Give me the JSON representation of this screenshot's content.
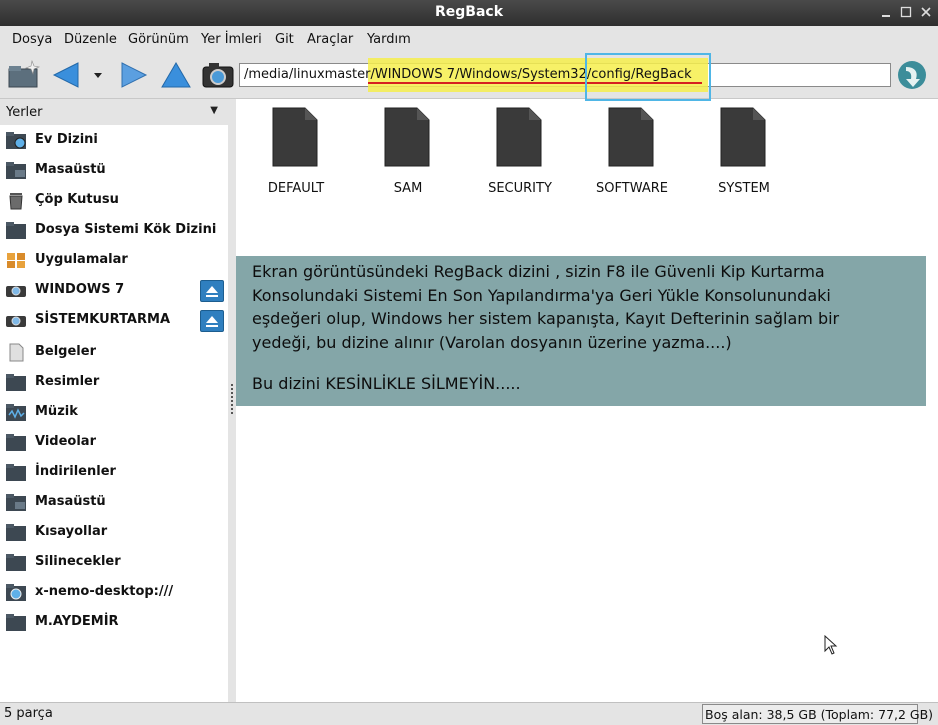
{
  "window": {
    "title": "RegBack"
  },
  "menu": [
    "Dosya",
    "Düzenle",
    "Görünüm",
    "Yer İmleri",
    "Git",
    "Araçlar",
    "Yardım"
  ],
  "toolbar": {
    "location": "/media/linuxmaster/WINDOWS 7/Windows/System32/config/RegBack"
  },
  "sidebar": {
    "header": "Yerler",
    "items": [
      {
        "label": "Ev Dizini",
        "icon": "home-folder-icon"
      },
      {
        "label": "Masaüstü",
        "icon": "desktop-icon"
      },
      {
        "label": "Çöp Kutusu",
        "icon": "trash-icon"
      },
      {
        "label": "Dosya Sistemi Kök Dizini",
        "icon": "root-folder-icon"
      },
      {
        "label": "Uygulamalar",
        "icon": "applications-icon"
      },
      {
        "label": "WINDOWS 7",
        "icon": "drive-icon"
      },
      {
        "label": "SİSTEMKURTARMA",
        "icon": "drive-icon"
      },
      {
        "label": "Belgeler",
        "icon": "documents-icon"
      },
      {
        "label": "Resimler",
        "icon": "pictures-icon"
      },
      {
        "label": "Müzik",
        "icon": "music-icon"
      },
      {
        "label": "Videolar",
        "icon": "videos-icon"
      },
      {
        "label": "İndirilenler",
        "icon": "downloads-icon"
      },
      {
        "label": "Masaüstü",
        "icon": "desktop-icon"
      },
      {
        "label": "Kısayollar",
        "icon": "shortcuts-icon"
      },
      {
        "label": "Silinecekler",
        "icon": "folder-icon"
      },
      {
        "label": "x-nemo-desktop:///",
        "icon": "network-icon"
      },
      {
        "label": "M.AYDEMİR",
        "icon": "folder-icon"
      }
    ]
  },
  "files": [
    "DEFAULT",
    "SAM",
    "SECURITY",
    "SOFTWARE",
    "SYSTEM"
  ],
  "note": {
    "lines": [
      "Ekran görüntüsündeki RegBack dizini , sizin F8 ile Güvenli Kip Kurtarma",
      "Konsolundaki Sistemi En Son Yapılandırma'ya Geri Yükle Konsolunundaki",
      "eşdeğeri olup, Windows her sistem kapanışta, Kayıt Defterinin sağlam bir",
      "yedeği, bu dizine alınır (Varolan dosyanın üzerine yazma....)"
    ],
    "warning": "Bu dizini KESİNLİKLE SİLMEYİN....."
  },
  "status": {
    "left": "5 parça",
    "right": "Boş alan: 38,5 GB (Toplam: 77,2 GB)"
  }
}
